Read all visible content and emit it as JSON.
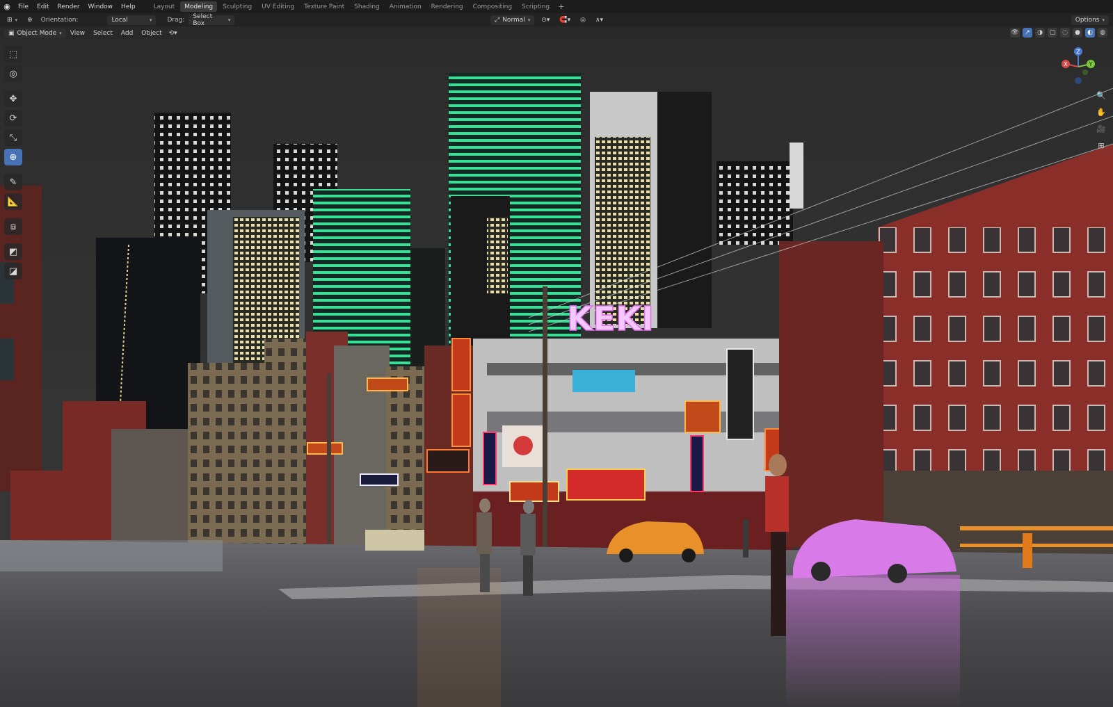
{
  "topbar": {
    "menus": [
      "File",
      "Edit",
      "Render",
      "Window",
      "Help"
    ],
    "workspaces": [
      "Layout",
      "Modeling",
      "Sculpting",
      "UV Editing",
      "Texture Paint",
      "Shading",
      "Animation",
      "Rendering",
      "Compositing",
      "Scripting"
    ],
    "active_workspace": "Modeling",
    "add_tab": "+"
  },
  "header": {
    "orientation_label": "Orientation:",
    "orientation_value": "Local",
    "drag_label": "Drag:",
    "drag_value": "Select Box",
    "transform_pivot": "Normal",
    "options_label": "Options"
  },
  "viewport_header": {
    "mode": "Object Mode",
    "menus": [
      "View",
      "Select",
      "Add",
      "Object"
    ]
  },
  "scene": {
    "signs": [
      "KEKI"
    ],
    "gizmo_axes": [
      "X",
      "Y",
      "Z"
    ]
  },
  "colors": {
    "accent": "#4772b3",
    "neon_green": "#3ddc97",
    "neon_pink": "#e06cf0",
    "brick_red": "#8a2e2a"
  }
}
